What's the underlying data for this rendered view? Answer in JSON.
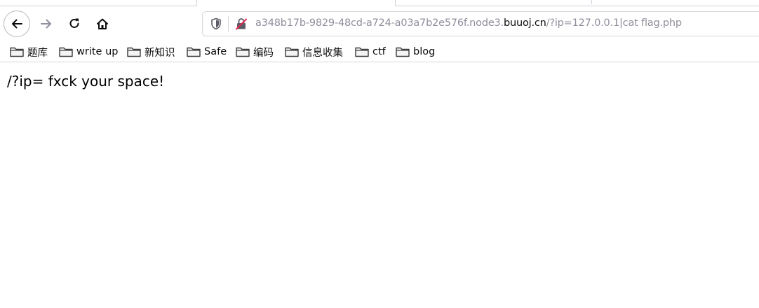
{
  "browser": {
    "nav": {
      "back_icon": "arrow-left-icon",
      "forward_icon": "arrow-right-icon",
      "reload_icon": "reload-icon",
      "home_icon": "home-icon"
    },
    "urlbar": {
      "url_prefix": "a348b17b-9829-48cd-a724-a03a7b2e576f.node3.",
      "url_domain": "buuoj.cn",
      "url_path": "/?ip=127.0.0.1|cat flag.php",
      "shield_icon": "shield-icon",
      "insecure_icon": "insecure-lock-icon"
    },
    "bookmarks": [
      {
        "label": "题库",
        "icon": "folder-icon"
      },
      {
        "label": "write up",
        "icon": "folder-icon"
      },
      {
        "label": "新知识",
        "icon": "folder-icon"
      },
      {
        "label": "Safe",
        "icon": "folder-icon"
      },
      {
        "label": "编码",
        "icon": "folder-icon"
      },
      {
        "label": "信息收集",
        "icon": "folder-icon"
      },
      {
        "label": "ctf",
        "icon": "folder-icon"
      },
      {
        "label": "blog",
        "icon": "folder-icon"
      }
    ]
  },
  "page": {
    "body_text": "/?ip= fxck your space!"
  },
  "colors": {
    "toolbar_border": "#d7d7db",
    "url_muted": "#8f8f9d",
    "text": "#0c0c0d"
  }
}
